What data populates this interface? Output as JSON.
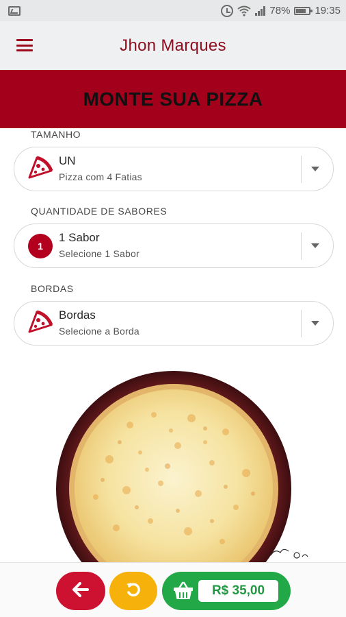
{
  "status_bar": {
    "battery": "78%",
    "time": "19:35"
  },
  "app_bar": {
    "title": "Jhon Marques"
  },
  "banner": {
    "title": "MONTE SUA PIZZA"
  },
  "sections": [
    {
      "label": "TAMANHO",
      "value": "UN",
      "subtitle": "Pizza com 4 Fatias",
      "icon": "pizza-slice-icon"
    },
    {
      "label": "QUANTIDADE DE SABORES",
      "value": "1 Sabor",
      "subtitle": "Selecione 1 Sabor",
      "badge": "1"
    },
    {
      "label": "BORDAS",
      "value": "Bordas",
      "subtitle": "Selecione a Borda",
      "icon": "pizza-slice-icon"
    }
  ],
  "bottom_bar": {
    "price": "R$ 35,00"
  },
  "colors": {
    "brand_red": "#a3001b",
    "back_button": "#cc1230",
    "reset_button": "#f7b10b",
    "cart_button": "#22a846"
  }
}
